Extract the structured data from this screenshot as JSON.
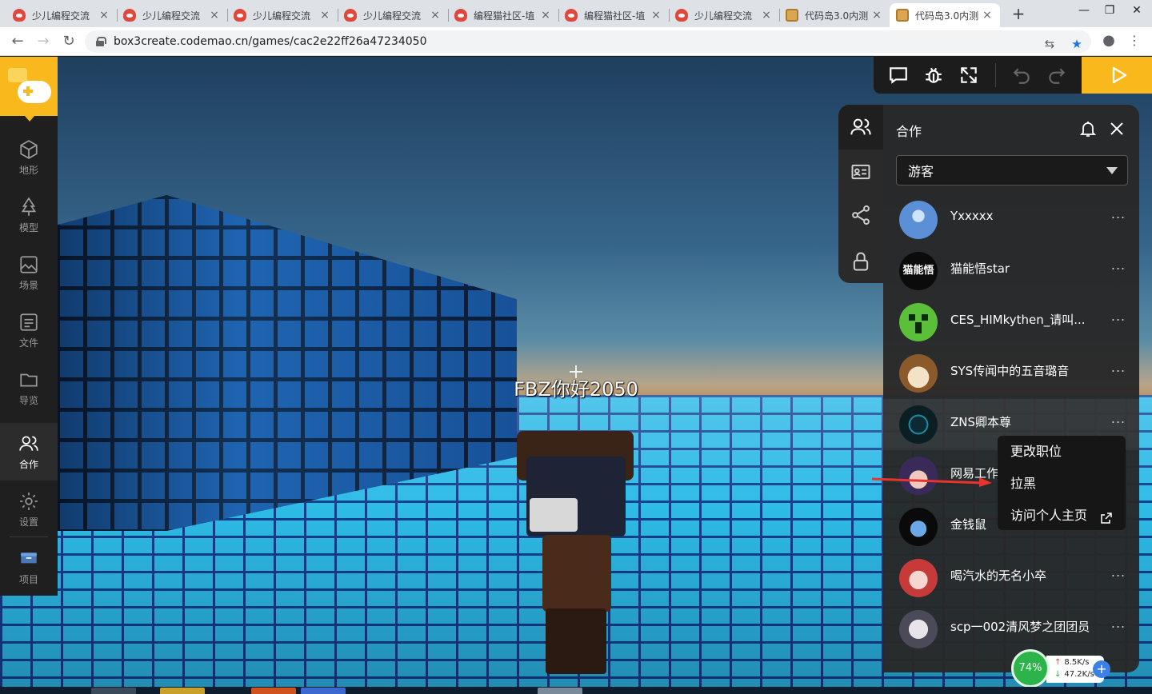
{
  "browser": {
    "tabs": [
      {
        "title": "少儿编程交流",
        "icon": "codemao-cat-icon"
      },
      {
        "title": "少儿编程交流",
        "icon": "codemao-cat-icon"
      },
      {
        "title": "少儿编程交流",
        "icon": "codemao-cat-icon"
      },
      {
        "title": "少儿编程交流",
        "icon": "codemao-cat-icon"
      },
      {
        "title": "编程猫社区-埴",
        "icon": "codemao-cat-icon"
      },
      {
        "title": "编程猫社区-埴",
        "icon": "codemao-cat-icon"
      },
      {
        "title": "少儿编程交流",
        "icon": "codemao-cat-icon"
      },
      {
        "title": "代码岛3.0内测",
        "icon": "box3-cube-icon"
      },
      {
        "title": "代码岛3.0内测",
        "icon": "box3-cube-icon",
        "active": true
      }
    ],
    "tab_close": "×",
    "new_tab": "+",
    "url": "box3create.codemao.cn/games/cac2e22ff26a47234050"
  },
  "sidebar": {
    "items": [
      {
        "label": "地形",
        "icon": "cube-icon"
      },
      {
        "label": "模型",
        "icon": "tree-icon"
      },
      {
        "label": "场景",
        "icon": "image-icon"
      },
      {
        "label": "文件",
        "icon": "file-list-icon"
      },
      {
        "label": "导览",
        "icon": "folder-icon"
      },
      {
        "label": "合作",
        "icon": "users-icon",
        "active": true
      },
      {
        "label": "设置",
        "icon": "gear-icon"
      },
      {
        "label": "项目",
        "icon": "project-icon"
      }
    ]
  },
  "scene": {
    "player_name": "FBZ你好2050"
  },
  "panel": {
    "title": "合作",
    "role_select": "游客",
    "members": [
      {
        "name": "Yxxxxx"
      },
      {
        "name": "猫能悟star",
        "avatar_text": "猫能悟"
      },
      {
        "name": "CES_HIMkythen_请叫..."
      },
      {
        "name": "SYS传闻中的五音璐音"
      },
      {
        "name": "ZNS卿本尊"
      },
      {
        "name": "网易工作"
      },
      {
        "name": "金钱鼠"
      },
      {
        "name": "喝汽水的无名小卒"
      },
      {
        "name": "scp一002清风梦之团团员"
      }
    ],
    "more_label": "...",
    "context_menu": [
      "更改职位",
      "拉黑",
      "访问个人主页"
    ]
  },
  "speed": {
    "percent": "74%",
    "up": "8.5K/s",
    "down": "47.2K/s",
    "up_arrow": "↑",
    "down_arrow": "↓",
    "plus": "+"
  },
  "colors": {
    "accent": "#f9b81b",
    "panel_bg": "#282828",
    "speed_green": "#2cb34a",
    "annotation_red": "#e8332f"
  }
}
